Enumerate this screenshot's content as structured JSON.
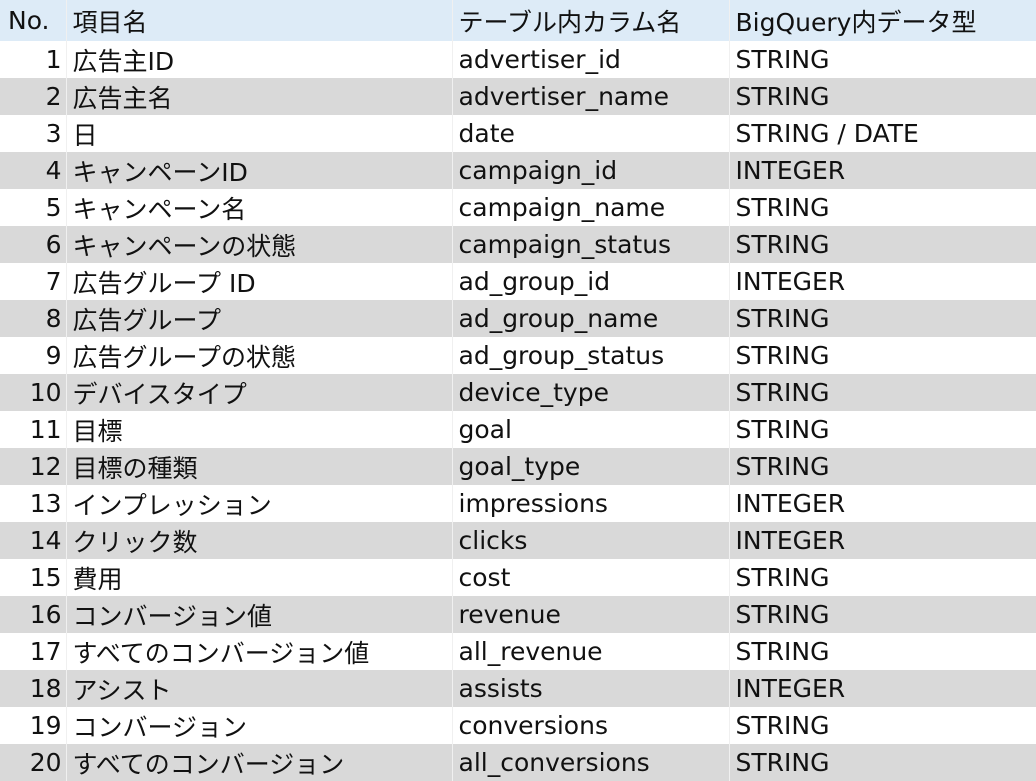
{
  "header": {
    "no": "No.",
    "item": "項目名",
    "column": "テーブル内カラム名",
    "type": "BigQuery内データ型"
  },
  "rows": [
    {
      "no": "1",
      "item": "広告主ID",
      "column": "advertiser_id",
      "type": "STRING"
    },
    {
      "no": "2",
      "item": "広告主名",
      "column": "advertiser_name",
      "type": "STRING"
    },
    {
      "no": "3",
      "item": "日",
      "column": "date",
      "type": "STRING / DATE"
    },
    {
      "no": "4",
      "item": "キャンペーンID",
      "column": "campaign_id",
      "type": "INTEGER"
    },
    {
      "no": "5",
      "item": "キャンペーン名",
      "column": "campaign_name",
      "type": "STRING"
    },
    {
      "no": "6",
      "item": "キャンペーンの状態",
      "column": "campaign_status",
      "type": "STRING"
    },
    {
      "no": "7",
      "item": "広告グループ ID",
      "column": "ad_group_id",
      "type": "INTEGER"
    },
    {
      "no": "8",
      "item": "広告グループ",
      "column": "ad_group_name",
      "type": "STRING"
    },
    {
      "no": "9",
      "item": "広告グループの状態",
      "column": "ad_group_status",
      "type": "STRING"
    },
    {
      "no": "10",
      "item": "デバイスタイプ",
      "column": "device_type",
      "type": "STRING"
    },
    {
      "no": "11",
      "item": "目標",
      "column": "goal",
      "type": "STRING"
    },
    {
      "no": "12",
      "item": "目標の種類",
      "column": "goal_type",
      "type": "STRING"
    },
    {
      "no": "13",
      "item": "インプレッション",
      "column": "impressions",
      "type": "INTEGER"
    },
    {
      "no": "14",
      "item": "クリック数",
      "column": "clicks",
      "type": "INTEGER"
    },
    {
      "no": "15",
      "item": "費用",
      "column": "cost",
      "type": "STRING"
    },
    {
      "no": "16",
      "item": "コンバージョン値",
      "column": "revenue",
      "type": "STRING"
    },
    {
      "no": "17",
      "item": "すべてのコンバージョン値",
      "column": "all_revenue",
      "type": "STRING"
    },
    {
      "no": "18",
      "item": "アシスト",
      "column": "assists",
      "type": "INTEGER"
    },
    {
      "no": "19",
      "item": "コンバージョン",
      "column": "conversions",
      "type": "STRING"
    },
    {
      "no": "20",
      "item": "すべてのコンバージョン",
      "column": "all_conversions",
      "type": "STRING"
    }
  ]
}
